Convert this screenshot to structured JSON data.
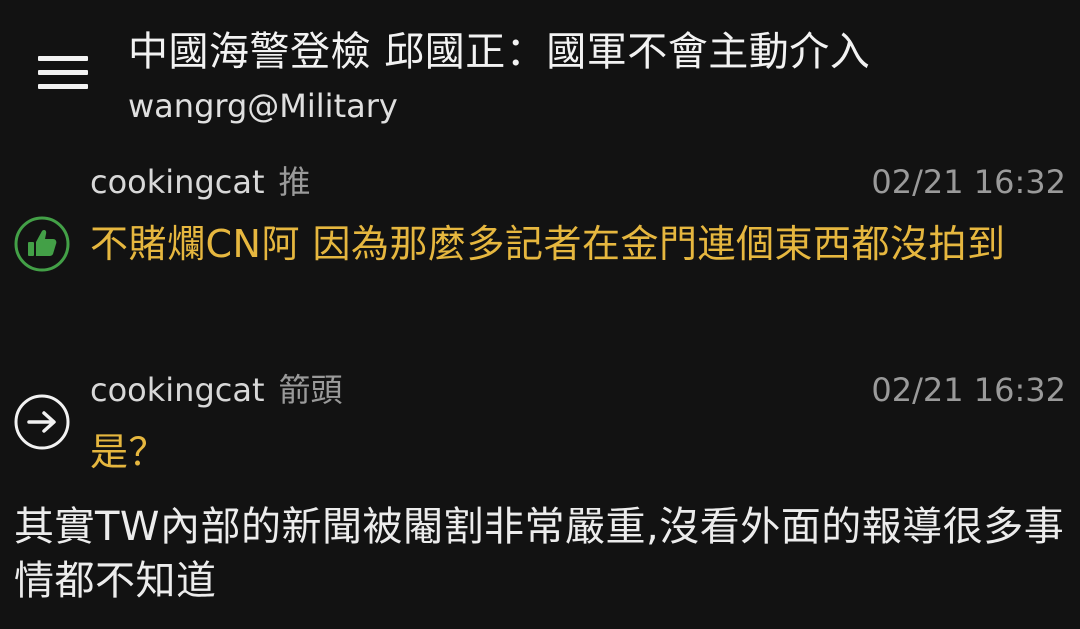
{
  "header": {
    "title": "中國海警登檢 邱國正：國軍不會主動介入",
    "board": "wangrg@Military"
  },
  "comments": [
    {
      "author": "cookingcat",
      "tag": "推",
      "time": "02/21 16:32",
      "text": "不賭爛CN阿 因為那麼多記者在金門連個東西都沒拍到",
      "icon": "thumbs-up-icon",
      "icon_color": "#43a047"
    },
    {
      "author": "cookingcat",
      "tag": "箭頭",
      "time": "02/21 16:32",
      "text": "是？",
      "icon": "arrow-right-circle-icon",
      "icon_color": "#f2f2f2"
    }
  ],
  "body": {
    "text": "其實TW內部的新聞被閹割非常嚴重,沒看外面的報導很多事情都不知道"
  },
  "colors": {
    "background": "#121212",
    "comment_text": "#e6b73f",
    "meta_gray": "#9a9a9a"
  }
}
